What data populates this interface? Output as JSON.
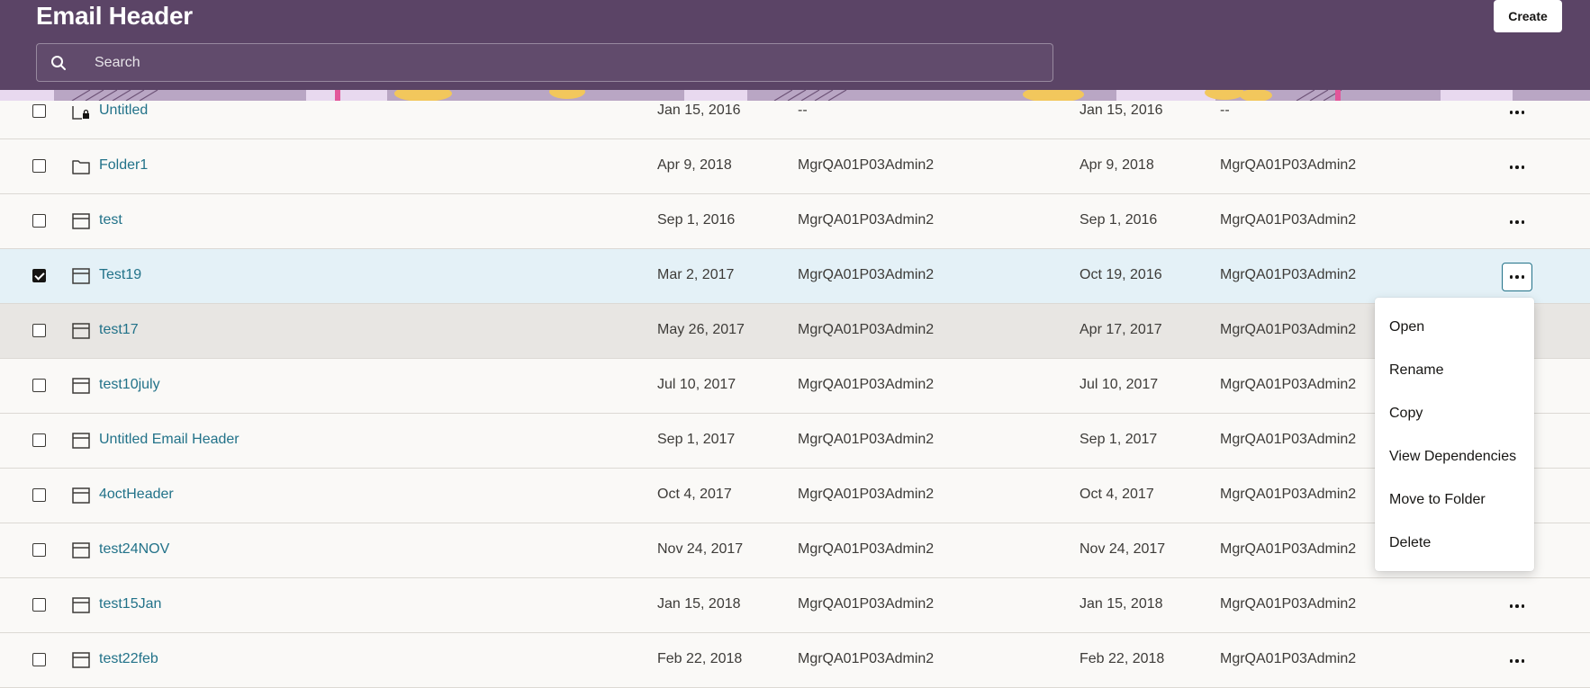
{
  "header": {
    "title": "Email Header",
    "create_label": "Create",
    "search_placeholder": "Search"
  },
  "rows": [
    {
      "name": "Untitled",
      "icon": "locked-folder-icon",
      "created": "Jan 15, 2016",
      "created_by": "--",
      "modified": "Jan 15, 2016",
      "modified_by": "--",
      "checked": false,
      "state": "partial"
    },
    {
      "name": "Folder1",
      "icon": "folder-icon",
      "created": "Apr 9, 2018",
      "created_by": "MgrQA01P03Admin2",
      "modified": "Apr 9, 2018",
      "modified_by": "MgrQA01P03Admin2",
      "checked": false,
      "state": ""
    },
    {
      "name": "test",
      "icon": "email-header-icon",
      "created": "Sep 1, 2016",
      "created_by": "MgrQA01P03Admin2",
      "modified": "Sep 1, 2016",
      "modified_by": "MgrQA01P03Admin2",
      "checked": false,
      "state": ""
    },
    {
      "name": "Test19",
      "icon": "email-header-icon",
      "created": "Mar 2, 2017",
      "created_by": "MgrQA01P03Admin2",
      "modified": "Oct 19, 2016",
      "modified_by": "MgrQA01P03Admin2",
      "checked": true,
      "state": "selected"
    },
    {
      "name": "test17",
      "icon": "email-header-icon",
      "created": "May 26, 2017",
      "created_by": "MgrQA01P03Admin2",
      "modified": "Apr 17, 2017",
      "modified_by": "MgrQA01P03Admin2",
      "checked": false,
      "state": "hovered"
    },
    {
      "name": "test10july",
      "icon": "email-header-icon",
      "created": "Jul 10, 2017",
      "created_by": "MgrQA01P03Admin2",
      "modified": "Jul 10, 2017",
      "modified_by": "MgrQA01P03Admin2",
      "checked": false,
      "state": ""
    },
    {
      "name": "Untitled Email Header",
      "icon": "email-header-icon",
      "created": "Sep 1, 2017",
      "created_by": "MgrQA01P03Admin2",
      "modified": "Sep 1, 2017",
      "modified_by": "MgrQA01P03Admin2",
      "checked": false,
      "state": ""
    },
    {
      "name": "4octHeader",
      "icon": "email-header-icon",
      "created": "Oct 4, 2017",
      "created_by": "MgrQA01P03Admin2",
      "modified": "Oct 4, 2017",
      "modified_by": "MgrQA01P03Admin2",
      "checked": false,
      "state": ""
    },
    {
      "name": "test24NOV",
      "icon": "email-header-icon",
      "created": "Nov 24, 2017",
      "created_by": "MgrQA01P03Admin2",
      "modified": "Nov 24, 2017",
      "modified_by": "MgrQA01P03Admin2",
      "checked": false,
      "state": ""
    },
    {
      "name": "test15Jan",
      "icon": "email-header-icon",
      "created": "Jan 15, 2018",
      "created_by": "MgrQA01P03Admin2",
      "modified": "Jan 15, 2018",
      "modified_by": "MgrQA01P03Admin2",
      "checked": false,
      "state": ""
    },
    {
      "name": "test22feb",
      "icon": "email-header-icon",
      "created": "Feb 22, 2018",
      "created_by": "MgrQA01P03Admin2",
      "modified": "Feb 22, 2018",
      "modified_by": "MgrQA01P03Admin2",
      "checked": false,
      "state": ""
    }
  ],
  "context_menu": {
    "items": [
      "Open",
      "Rename",
      "Copy",
      "View Dependencies",
      "Move to Folder",
      "Delete"
    ]
  },
  "colors": {
    "header_bg": "#5b4466",
    "link": "#227289",
    "selected_row": "#e4f1f7",
    "hovered_row": "#e8e6e3"
  }
}
